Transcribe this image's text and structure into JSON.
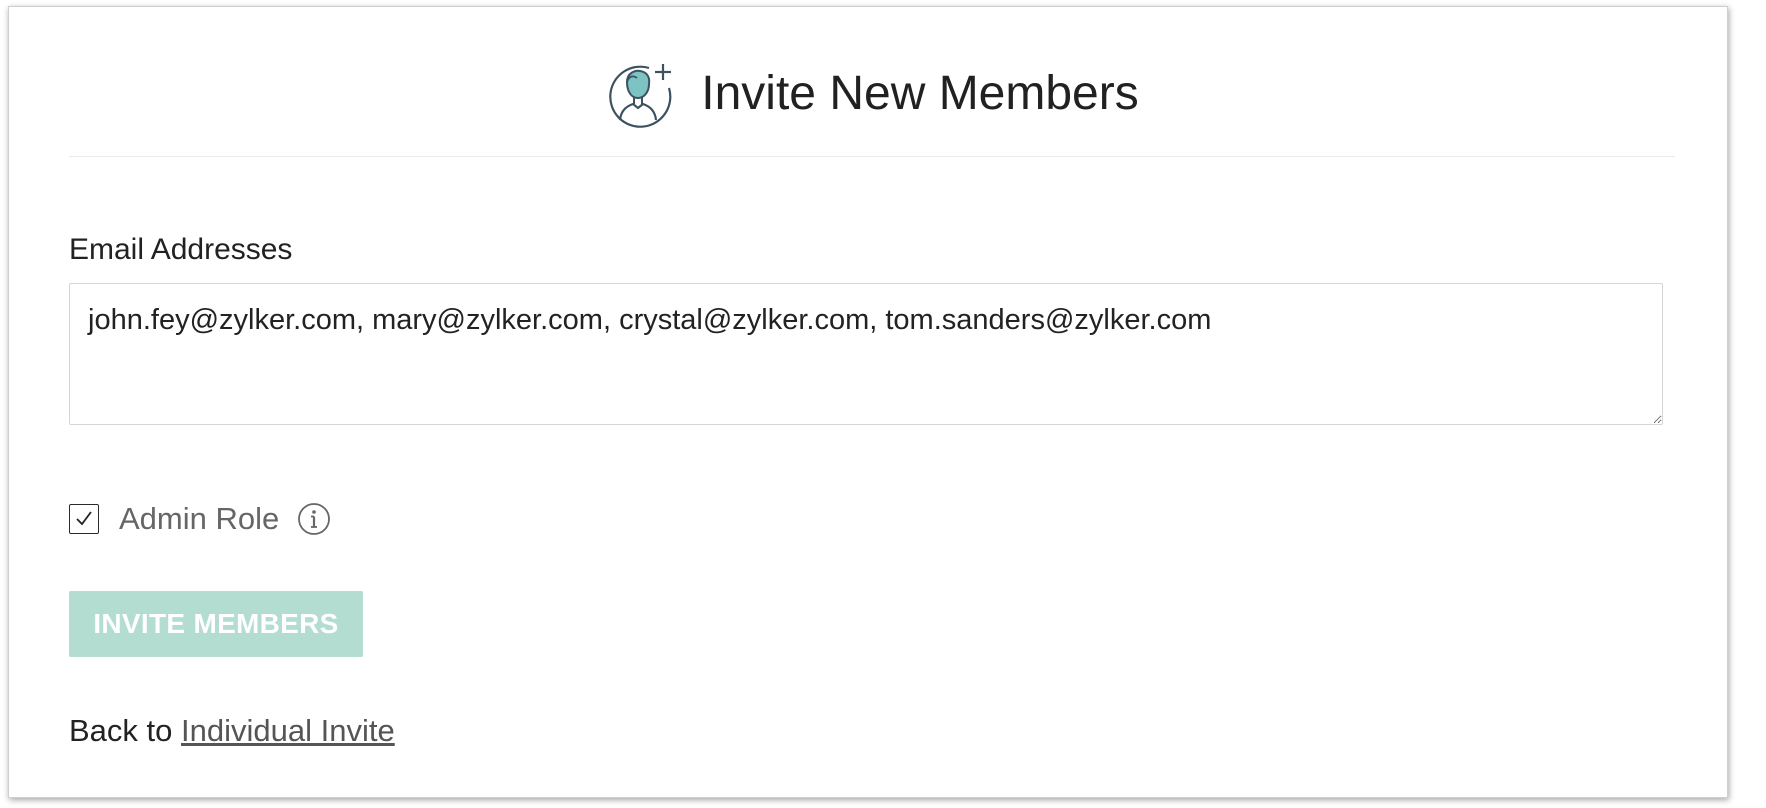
{
  "header": {
    "title": "Invite New Members",
    "icon": "add-user-icon"
  },
  "form": {
    "email_label": "Email Addresses",
    "email_value": "john.fey@zylker.com, mary@zylker.com, crystal@zylker.com, tom.sanders@zylker.com",
    "admin_role": {
      "label": "Admin Role",
      "checked": true,
      "info_icon": "info-icon"
    },
    "submit_label": "INVITE MEMBERS"
  },
  "footer": {
    "back_prefix": "Back to",
    "back_link": "Individual Invite"
  },
  "colors": {
    "accent": "#7ec3c4",
    "button_disabled": "#b3ddd1",
    "text": "#222222",
    "muted": "#666666"
  }
}
